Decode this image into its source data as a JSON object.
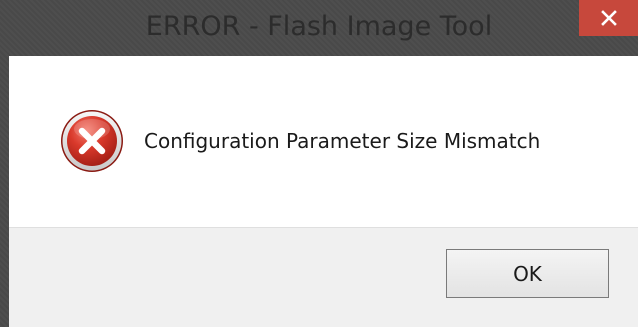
{
  "window": {
    "title": "ERROR - Flash Image Tool",
    "close_icon": "close-icon"
  },
  "dialog": {
    "icon": "error-icon",
    "message": "Configuration Parameter Size Mismatch"
  },
  "buttons": {
    "ok_label": "OK"
  },
  "colors": {
    "frame": "#4a4a4a",
    "close_button": "#c7483c",
    "content_bg": "#ffffff",
    "footer_bg": "#f0f0f0",
    "error_red": "#d23a30"
  }
}
